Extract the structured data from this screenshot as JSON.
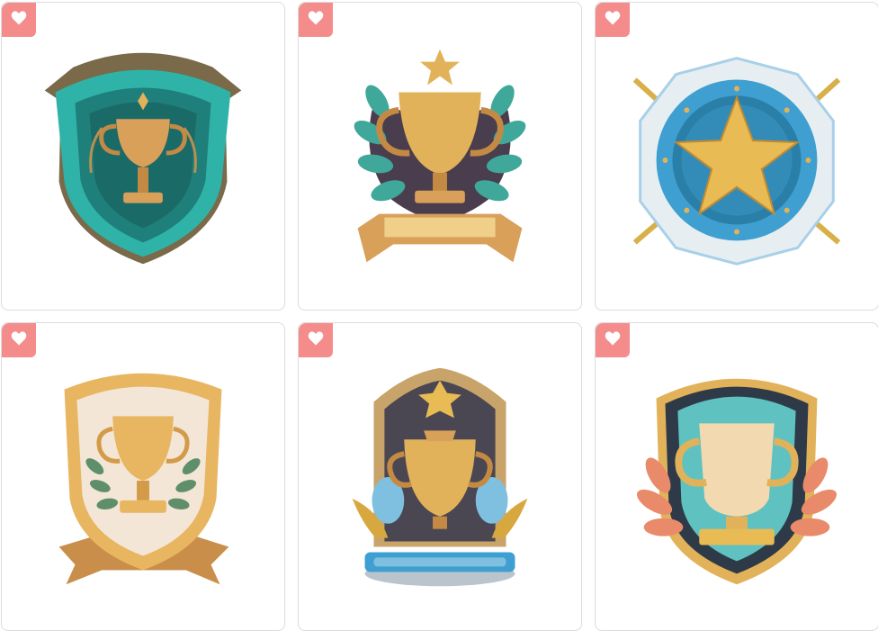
{
  "gallery": {
    "colors": {
      "favorite_badge": "#f48c8c",
      "card_border": "#dcdcdc",
      "gold": "#e2b25a",
      "teal": "#2fb3a8",
      "blue": "#3e9fd0"
    },
    "items": [
      {
        "name": "teal-shield-trophy-badge",
        "icon": "heart-icon"
      },
      {
        "name": "laurel-wreath-trophy-badge",
        "icon": "heart-icon"
      },
      {
        "name": "star-medal-badge",
        "icon": "heart-icon"
      },
      {
        "name": "cream-shield-trophy-badge",
        "icon": "heart-icon"
      },
      {
        "name": "star-crest-trophy-badge",
        "icon": "heart-icon"
      },
      {
        "name": "dark-shield-cup-badge",
        "icon": "heart-icon"
      }
    ]
  }
}
